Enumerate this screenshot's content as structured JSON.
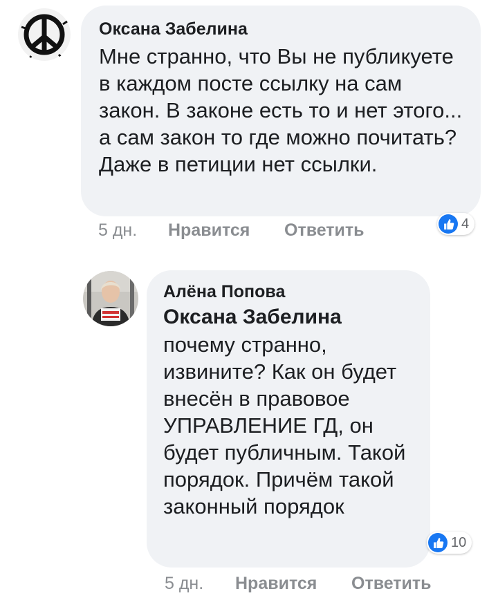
{
  "comments": [
    {
      "author": "Оксана Забелина",
      "text": "Мне странно, что Вы не публикуете в каждом посте ссылку на сам закон. В законе есть то и нет этого... а сам закон то где можно почитать? Даже в петиции нет ссылки.",
      "time": "5 дн.",
      "like_label": "Нравится",
      "reply_label": "Ответить",
      "reaction_count": "4",
      "reaction_icon": "like-icon"
    },
    {
      "author": "Алёна Попова",
      "mention": "Оксана Забелина",
      "text": "почему странно, извините? Как он будет внесён в правовое УПРАВЛЕНИЕ ГД, он будет публичным. Такой порядок. Причём такой законный порядок",
      "time": "5 дн.",
      "like_label": "Нравится",
      "reply_label": "Ответить",
      "reaction_count": "10",
      "reaction_icon": "like-icon"
    }
  ],
  "colors": {
    "bubble": "#f0f2f5",
    "text": "#1c1e21",
    "meta": "#8a8d91",
    "like_blue": "#1877f2"
  }
}
